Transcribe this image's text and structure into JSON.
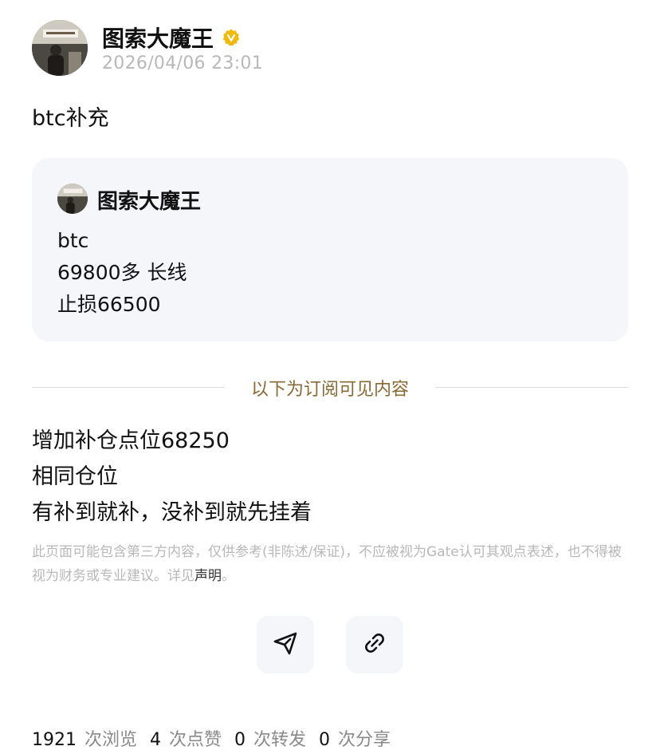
{
  "post": {
    "author_name": "图索大魔王",
    "timestamp": "2026/04/06 23:01",
    "title": "btc补充"
  },
  "quote": {
    "author_name": "图索大魔王",
    "lines": [
      "btc",
      "69800多 长线",
      "止损66500"
    ]
  },
  "subscription": {
    "divider_label": "以下为订阅可见内容",
    "lines": [
      "增加补仓点位68250",
      "相同仓位",
      "有补到就补，没补到就先挂着"
    ]
  },
  "disclaimer": {
    "text": "此页面可能包含第三方内容，仅供参考(非陈述/保证)，不应被视为Gate认可其观点表述，也不得被视为财务或专业建议。详见",
    "link_text": "声明",
    "suffix": "。"
  },
  "actions": {
    "share_icon": "send-icon",
    "link_icon": "link-icon"
  },
  "stats": {
    "views": "1921",
    "views_label": "次浏览",
    "likes": "4",
    "likes_label": "次点赞",
    "reposts": "0",
    "reposts_label": "次转发",
    "shares": "0",
    "shares_label": "次分享"
  },
  "colors": {
    "verified_badge": "#f0b90b",
    "divider_text": "#8a6a34",
    "card_bg": "#f4f6f9"
  }
}
